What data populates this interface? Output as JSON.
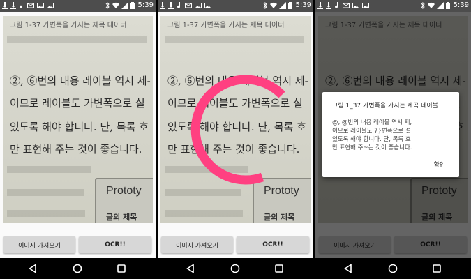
{
  "status_bar": {
    "time": "5:39"
  },
  "photo_text": {
    "caption": "그림 1-37 가변폭을 가지는 제목 데이터",
    "lines": [
      "②, ⑥번의 내용 레이블 역시 제-",
      "이므로 레이블도 가변폭으로 설",
      "있도록 해야 합니다. 단, 목록 호",
      "만 표현해 주는 것이 좋습니다."
    ],
    "proto_title": "Prototy",
    "proto_sub": "글의 제목"
  },
  "buttons": {
    "import": "이미지 가져오기",
    "ocr": "OCR!!"
  },
  "dialog": {
    "title": "그림 1_37 가변폭을 가지는 세곡 데이블",
    "message_lines": [
      "@, @번의 내용 레이블 역시 제,",
      "이므로 레이블도 7}변폭으로 설",
      "있도록 해야 합니다. 단, 목록 호",
      "만 표현해 주~는 것이 좋습니다."
    ],
    "ok": "확인"
  },
  "colors": {
    "spinner": "#ff4081",
    "status_bar": "#4d4d4d",
    "button": "#d7d7d7"
  }
}
